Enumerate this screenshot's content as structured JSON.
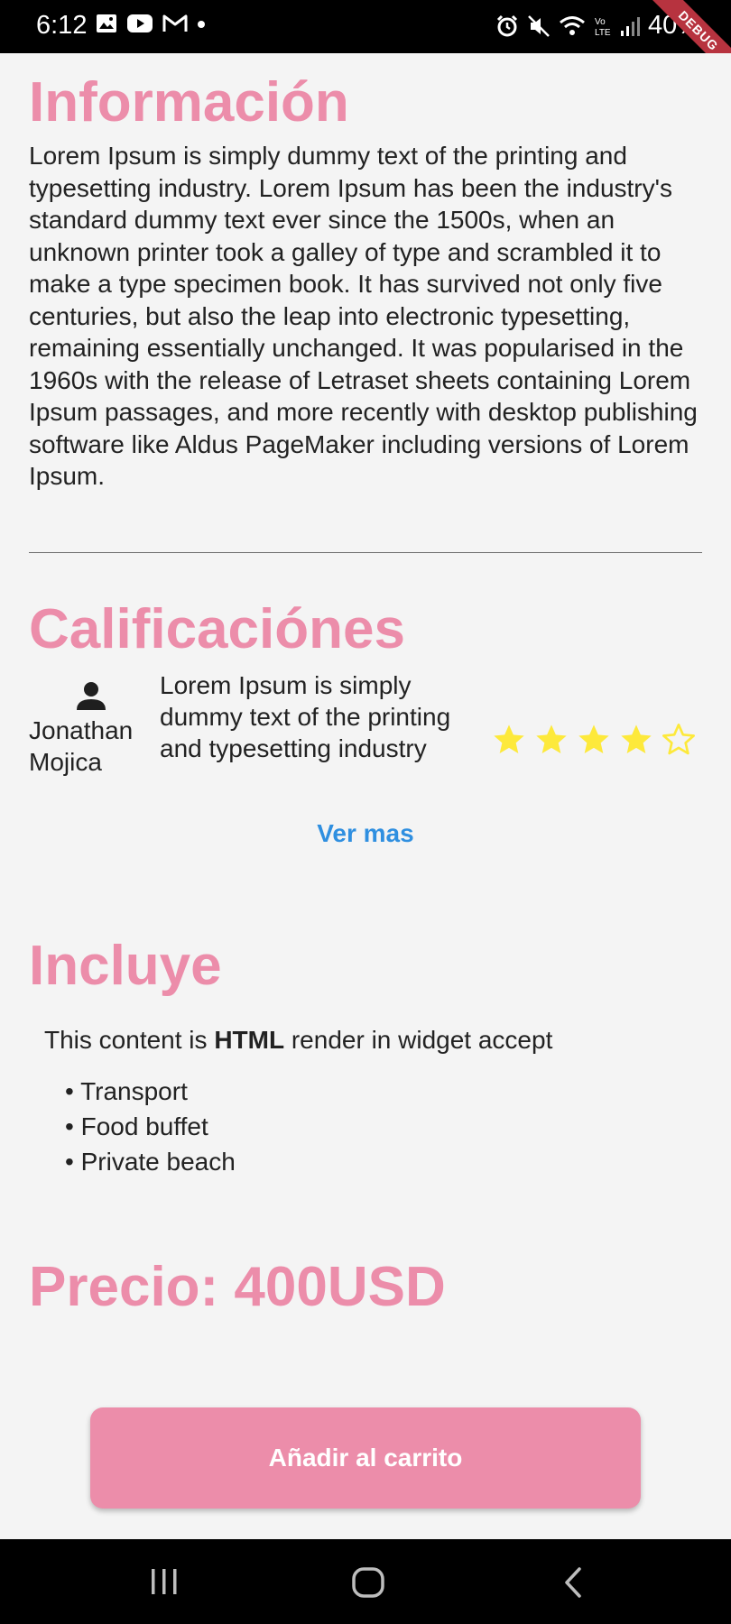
{
  "status_bar": {
    "time": "6:12",
    "battery": "40%",
    "debug_label": "DEBUG"
  },
  "info": {
    "title": "Información",
    "body": "Lorem Ipsum is simply dummy text of the printing and typesetting industry. Lorem Ipsum has been the industry's standard dummy text ever since the 1500s, when an unknown printer took a galley of type and scrambled it to make a type specimen book. It has survived not only five centuries, but also the leap into electronic typesetting, remaining essentially unchanged. It was popularised in the 1960s with the release of Letraset sheets containing Lorem Ipsum passages, and more recently with desktop publishing software like Aldus PageMaker including versions of Lorem Ipsum."
  },
  "ratings": {
    "title": "Calificaciónes",
    "reviews": [
      {
        "author": "Jonathan Mojica",
        "text": "Lorem Ipsum is simply dummy text of the printing and typesetting industry",
        "stars": 4,
        "max_stars": 5
      }
    ],
    "see_more": "Ver mas"
  },
  "includes": {
    "title": "Incluye",
    "intro_before": "This content is ",
    "intro_bold": "HTML",
    "intro_after": " render in widget accept",
    "items": [
      "Transport",
      "Food buffet",
      "Private beach"
    ]
  },
  "price": {
    "text": "Precio: 400USD"
  },
  "cart": {
    "button_label": "Añadir al carrito"
  },
  "colors": {
    "accent_pink": "#ec8daa",
    "link_blue": "#2f8fe0",
    "star_yellow": "#fde93b",
    "background": "#f4f4f4"
  },
  "icons": {
    "status_left": [
      "image-icon",
      "youtube-icon",
      "gmail-icon",
      "dot-icon"
    ],
    "status_right": [
      "alarm-icon",
      "mute-icon",
      "wifi-icon",
      "volte-icon",
      "signal-icon"
    ],
    "nav": [
      "recents-icon",
      "home-icon",
      "back-icon"
    ],
    "avatar": "person-icon"
  }
}
